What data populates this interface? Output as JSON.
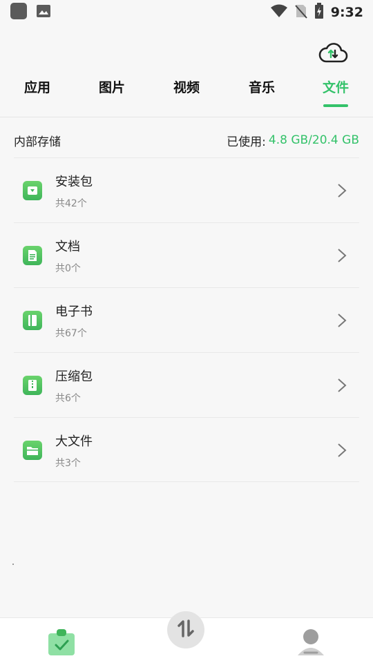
{
  "status_bar": {
    "time": "9:32",
    "icons": [
      "app-square-icon",
      "gallery-icon",
      "wifi-icon",
      "no-sim-icon",
      "battery-charging-icon"
    ]
  },
  "header": {
    "cloud_icon": "cloud-transfer-icon",
    "tabs": [
      {
        "label": "应用"
      },
      {
        "label": "图片"
      },
      {
        "label": "视频"
      },
      {
        "label": "音乐"
      },
      {
        "label": "文件"
      }
    ],
    "active_tab": "文件"
  },
  "storage": {
    "label": "内部存储",
    "used_label": "已使用:",
    "used_value": "4.8 GB/20.4 GB"
  },
  "items": [
    {
      "title": "安装包",
      "count": "共42个",
      "icon": "package-icon"
    },
    {
      "title": "文档",
      "count": "共0个",
      "icon": "document-icon"
    },
    {
      "title": "电子书",
      "count": "共67个",
      "icon": "ebook-icon"
    },
    {
      "title": "压缩包",
      "count": "共6个",
      "icon": "archive-icon"
    },
    {
      "title": "大文件",
      "count": "共3个",
      "icon": "folder-icon"
    }
  ],
  "bottom_nav": {
    "items": [
      "files-nav-icon",
      "transfer-nav-icon",
      "profile-nav-icon"
    ]
  },
  "colors": {
    "accent": "#34c26a",
    "background": "#f7f7f7",
    "text_primary": "#222222",
    "text_secondary": "#888888"
  }
}
